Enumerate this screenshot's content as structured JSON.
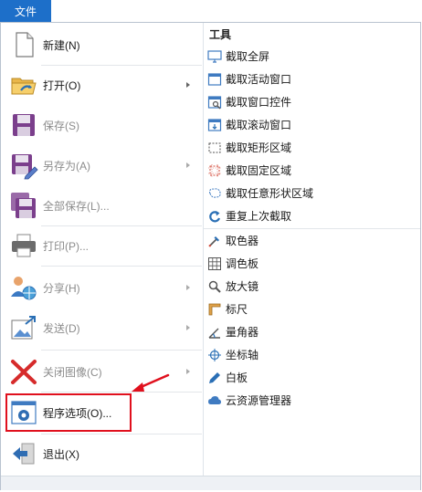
{
  "menubar": {
    "file_tab": "文件"
  },
  "left_menu": {
    "new": "新建(N)",
    "open": "打开(O)",
    "save": "保存(S)",
    "save_as": "另存为(A)",
    "save_all": "全部保存(L)...",
    "print": "打印(P)...",
    "share": "分享(H)",
    "send": "发送(D)",
    "close_image": "关闭图像(C)",
    "options": "程序选项(O)...",
    "exit": "退出(X)"
  },
  "tools": {
    "header": "工具",
    "items": [
      "截取全屏",
      "截取活动窗口",
      "截取窗口控件",
      "截取滚动窗口",
      "截取矩形区域",
      "截取固定区域",
      "截取任意形状区域",
      "重复上次截取",
      "取色器",
      "调色板",
      "放大镜",
      "标尺",
      "量角器",
      "坐标轴",
      "白板",
      "云资源管理器"
    ]
  },
  "colors": {
    "accent": "#1d6fc9",
    "highlight_box": "#e0101d",
    "disabled_text": "#8c8c8c"
  }
}
